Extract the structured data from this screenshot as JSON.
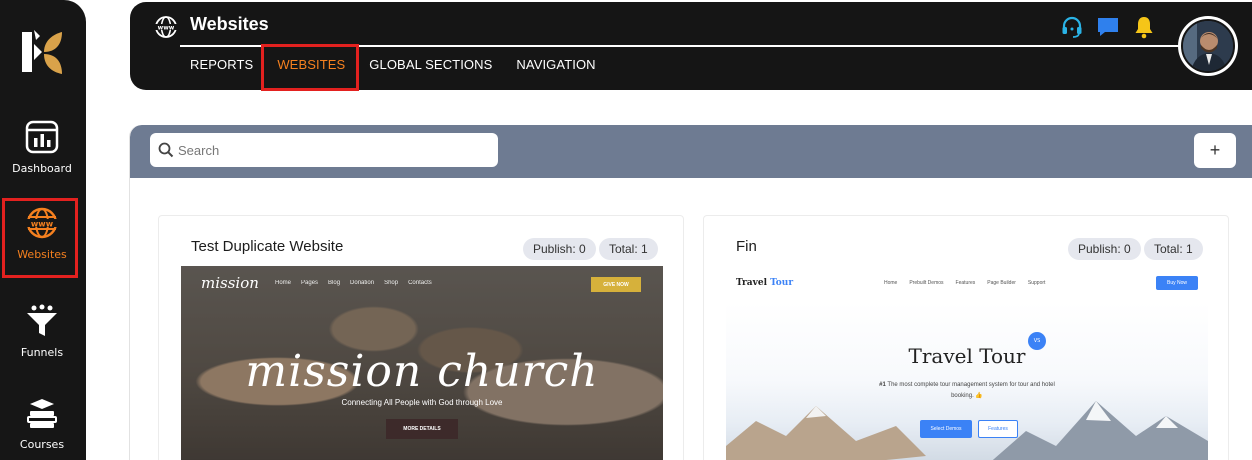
{
  "app": {
    "sidebar": {
      "items": [
        {
          "label": "Dashboard",
          "icon": "dashboard-icon"
        },
        {
          "label": "Websites",
          "icon": "globe-www-icon",
          "active": true
        },
        {
          "label": "Funnels",
          "icon": "funnel-icon"
        },
        {
          "label": "Courses",
          "icon": "books-icon"
        }
      ]
    },
    "header": {
      "title": "Websites",
      "icon": "globe-www-icon",
      "tabs": [
        {
          "label": "REPORTS"
        },
        {
          "label": "WEBSITES",
          "active": true
        },
        {
          "label": "GLOBAL SECTIONS"
        },
        {
          "label": "NAVIGATION"
        }
      ],
      "icons": [
        "headset-icon",
        "chat-icon",
        "bell-icon",
        "avatar"
      ]
    },
    "toolbar": {
      "search_placeholder": "Search",
      "add_label": "+"
    },
    "cards": [
      {
        "title": "Test Duplicate Website",
        "publish": "Publish: 0",
        "total": "Total: 1",
        "preview": {
          "logo": "mission",
          "nav": [
            "Home",
            "Pages",
            "Blog",
            "Donation",
            "Shop",
            "Contacts"
          ],
          "cta": "GIVE NOW",
          "hero": "mission church",
          "subtitle": "Connecting All People with God through Love",
          "button": "MORE DETAILS"
        }
      },
      {
        "title": "Fin",
        "publish": "Publish: 0",
        "total": "Total: 1",
        "preview": {
          "logo_a": "Travel",
          "logo_b": "Tour",
          "nav": [
            "Home",
            "Prebuilt Demos",
            "Features",
            "Page Builder",
            "Support"
          ],
          "cta": "Buy Now",
          "badge": "VS",
          "hero": "Travel Tour",
          "desc_prefix": "#1",
          "desc": "The most complete tour management system for tour and hotel booking. 👍",
          "primary_btn": "Select Demos",
          "secondary_btn": "Features"
        }
      }
    ],
    "colors": {
      "accent": "#f5801f",
      "highlight": "#e3211f",
      "dark": "#151515",
      "toolbar": "#6e7b92",
      "headset": "#2ab3e6",
      "chat": "#2f80ed",
      "bell": "#f5c518"
    }
  }
}
